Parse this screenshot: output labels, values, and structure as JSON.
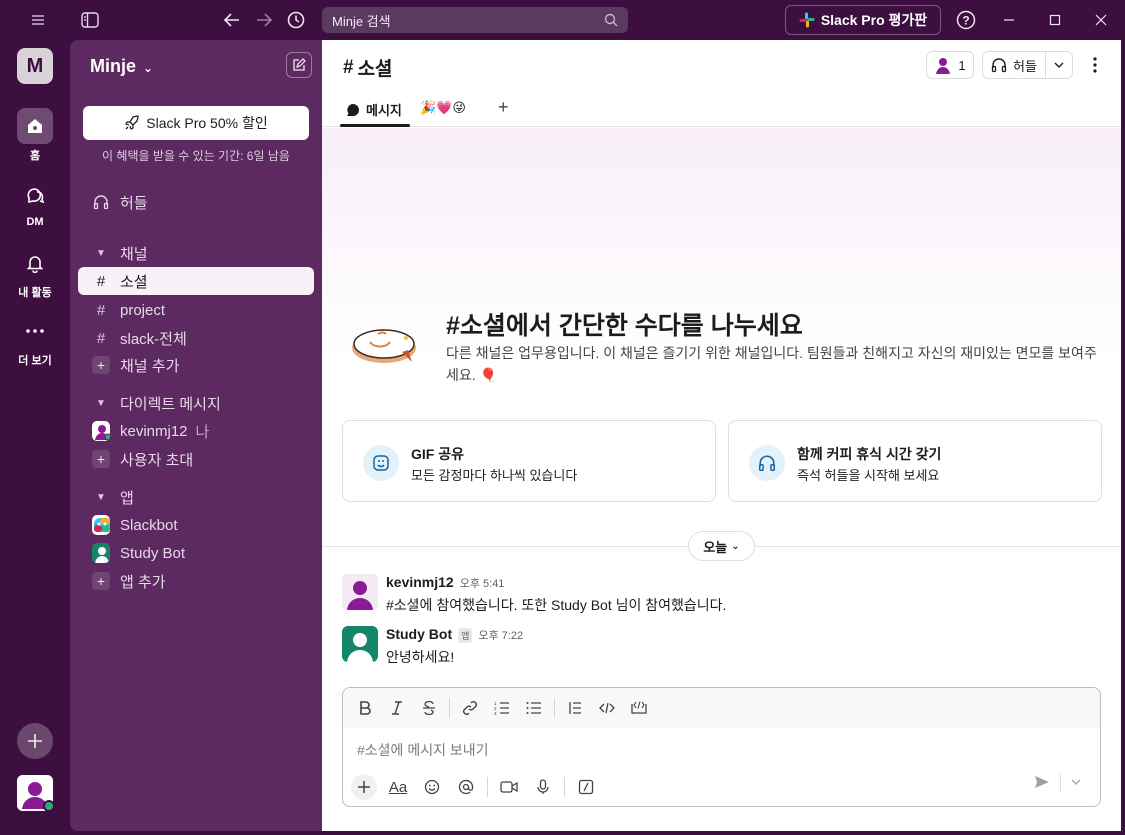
{
  "titlebar": {
    "search_placeholder": "Minje 검색",
    "pro_button": "Slack Pro 평가판"
  },
  "rail": {
    "workspace_initial": "M",
    "items": [
      {
        "label": "홈"
      },
      {
        "label": "DM"
      },
      {
        "label": "내 활동"
      },
      {
        "label": "더 보기"
      }
    ]
  },
  "sidebar": {
    "workspace_name": "Minje",
    "promo_button": "Slack Pro 50% 할인",
    "promo_subtext": "이 혜택을 받을 수 있는 기간: 6일 남음",
    "huddles_label": "허들",
    "channels_header": "채널",
    "channels": [
      "소셜",
      "project",
      "slack-전체"
    ],
    "add_channel": "채널 추가",
    "dm_header": "다이렉트 메시지",
    "dm_user": "kevinmj12",
    "dm_me_tag": "나",
    "invite_people": "사용자 초대",
    "apps_header": "앱",
    "apps": [
      "Slackbot",
      "Study Bot"
    ],
    "add_app": "앱 추가"
  },
  "main": {
    "channel_name": "소셜",
    "member_count": "1",
    "huddle_label": "허들",
    "tabs": {
      "messages": "메시지",
      "emoji_tab": "🎉💗😜"
    },
    "hero_title": "소셜에서 간단한 수다를 나누세요",
    "hero_desc": "다른 채널은 업무용입니다. 이 채널은 즐기기 위한 채널입니다. 팀원들과 친해지고 자신의 재미있는 면모를 보여주세요. 🎈",
    "cards": [
      {
        "title": "GIF 공유",
        "subtitle": "모든 감정마다 하나씩 있습니다"
      },
      {
        "title": "함께 커피 휴식 시간 갖기",
        "subtitle": "즉석 허들을 시작해 보세요"
      }
    ],
    "date_divider": "오늘",
    "messages": [
      {
        "name": "kevinmj12",
        "time": "오후 5:41",
        "text": "#소셜에 참여했습니다. 또한 Study Bot 님이 참여했습니다."
      },
      {
        "name": "Study Bot",
        "badge": "앱",
        "time": "오후 7:22",
        "text": "안녕하세요!"
      }
    ],
    "composer_placeholder": "#소셜에 메시지 보내기",
    "format_text_label": "Aa"
  }
}
